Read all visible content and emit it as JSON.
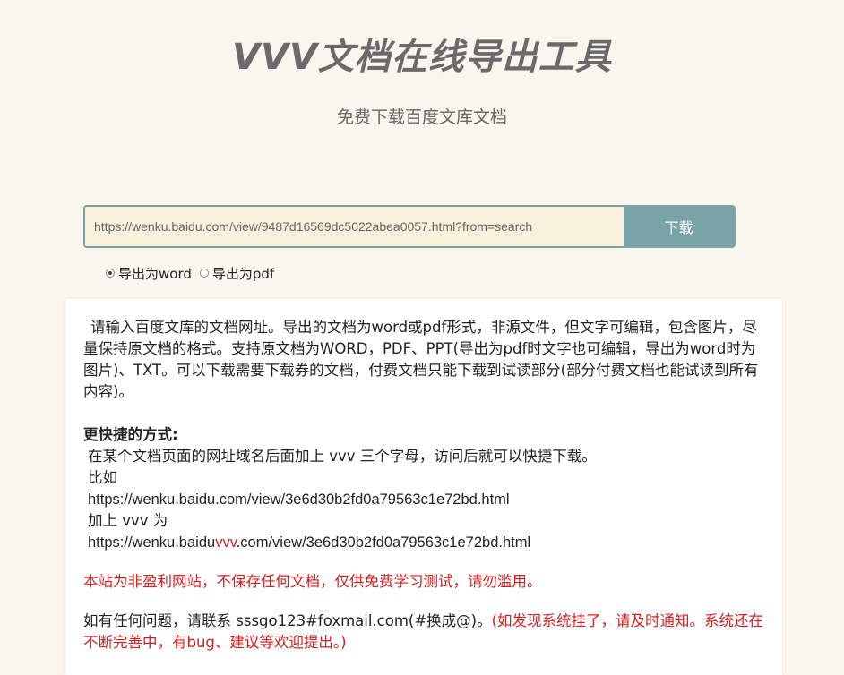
{
  "header": {
    "title": "VVV文档在线导出工具",
    "subtitle": "免费下载百度文库文档"
  },
  "search": {
    "url_value": "https://wenku.baidu.com/view/9487d16569dc5022abea0057.html?from=search",
    "download_label": "下载"
  },
  "format": {
    "options": [
      {
        "label": "导出为word",
        "selected": true
      },
      {
        "label": "导出为pdf",
        "selected": false
      }
    ]
  },
  "info": {
    "intro": "请输入百度文库的文档网址。导出的文档为word或pdf形式，非源文件，但文字可编辑，包含图片，尽量保持原文档的格式。支持原文档为WORD，PDF、PPT(导出为pdf时文字也可编辑，导出为word时为图片)、TXT。可以下载需要下载券的文档，付费文档只能下载到试读部分(部分付费文档也能试读到所有内容)。",
    "faster_title": "更快捷的方式:",
    "faster_desc": "在某个文档页面的网址域名后面加上 vvv 三个字母，访问后就可以快捷下载。",
    "example_label": "比如",
    "example_url": "https://wenku.baidu.com/view/3e6d30b2fd0a79563c1e72bd.html",
    "add_label": "加上 vvv 为",
    "result_url_prefix": "https://wenku.baidu",
    "result_url_highlight": "vvv",
    "result_url_suffix": ".com/view/3e6d30b2fd0a79563c1e72bd.html",
    "notice": "本站为非盈利网站，不保存任何文档，仅供免费学习测试，请勿滥用。",
    "contact_prefix": "如有任何问题，请联系 sssgo123#foxmail.com(#换成@)。",
    "contact_red": "(如发现系统挂了，请及时通知。系统还在不断完善中，有bug、建议等欢迎提出。)"
  },
  "colors": {
    "background": "#f9f6ee",
    "accent": "#7aa3a8",
    "input_bg": "#f8f0da",
    "warning_red": "#d42020"
  }
}
